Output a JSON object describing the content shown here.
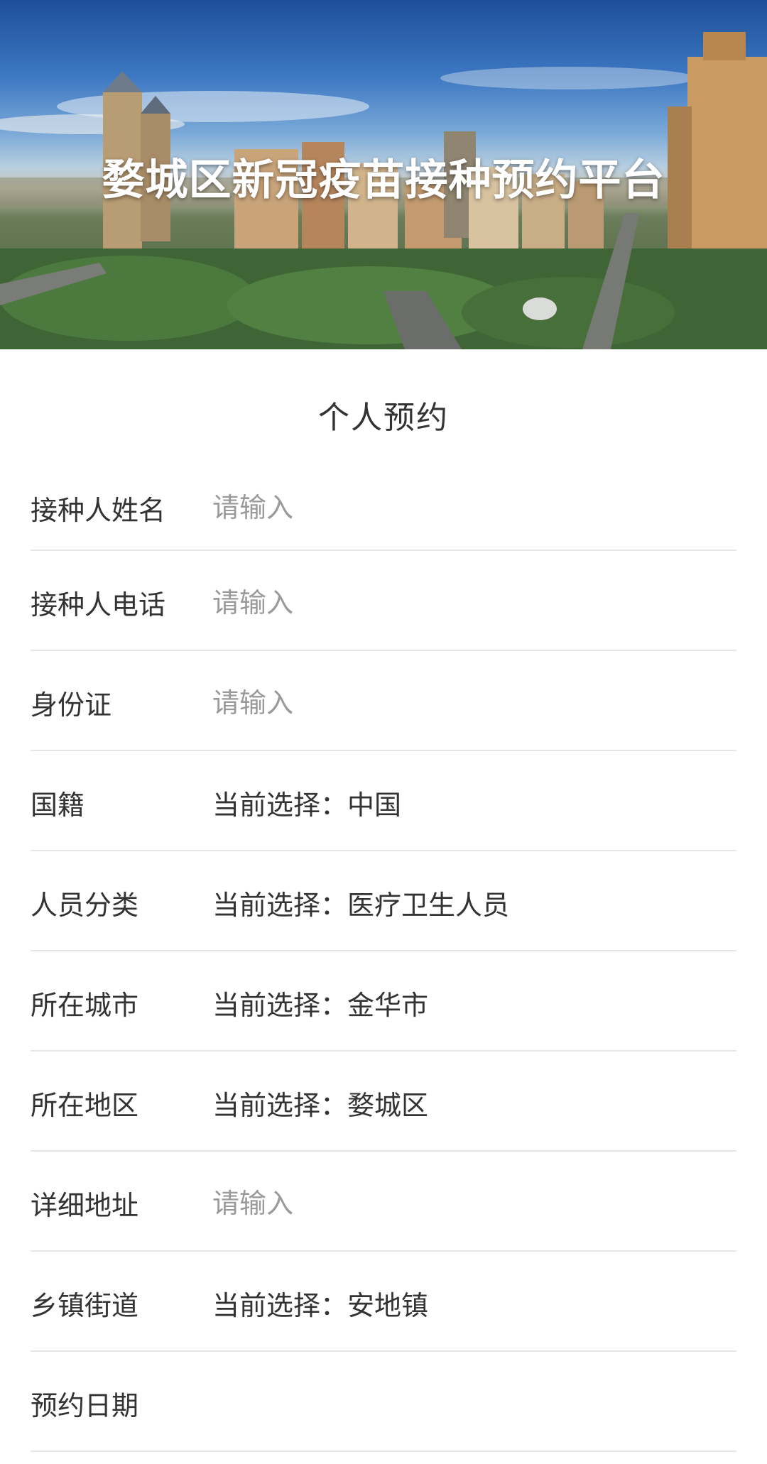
{
  "banner": {
    "title": "婺城区新冠疫苗接种预约平台"
  },
  "form": {
    "section_title": "个人预约",
    "fields": [
      {
        "label": "接种人姓名",
        "type": "input",
        "placeholder": "请输入"
      },
      {
        "label": "接种人电话",
        "type": "input",
        "placeholder": "请输入"
      },
      {
        "label": "身份证",
        "type": "input",
        "placeholder": "请输入"
      },
      {
        "label": "国籍",
        "type": "select",
        "value": "当前选择：中国"
      },
      {
        "label": "人员分类",
        "type": "select",
        "value": "当前选择：医疗卫生人员"
      },
      {
        "label": "所在城市",
        "type": "select",
        "value": "当前选择：金华市"
      },
      {
        "label": "所在地区",
        "type": "select",
        "value": "当前选择：婺城区"
      },
      {
        "label": "详细地址",
        "type": "input",
        "placeholder": "请输入"
      },
      {
        "label": "乡镇街道",
        "type": "select",
        "value": "当前选择：安地镇"
      },
      {
        "label": "预约日期",
        "type": "select",
        "value": ""
      }
    ]
  },
  "colors": {
    "text": "#333333",
    "placeholder": "#9a9a9a",
    "divider": "#e6e6e6",
    "banner_title": "#ffffff"
  }
}
